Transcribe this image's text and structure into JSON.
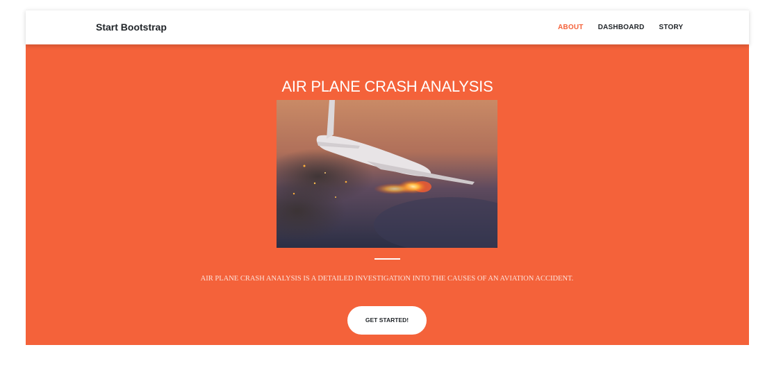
{
  "navbar": {
    "brand": "Start Bootstrap",
    "links": [
      {
        "label": "ABOUT",
        "active": true
      },
      {
        "label": "DASHBOARD",
        "active": false
      },
      {
        "label": "STORY",
        "active": false
      }
    ]
  },
  "hero": {
    "title": "AIR PLANE CRASH ANALYSIS",
    "lead": "AIR PLANE CRASH ANALYSIS IS A DETAILED INVESTIGATION INTO THE CAUSES OF AN AVIATION ACCIDENT.",
    "cta_label": "GET STARTED!",
    "image_icon": "burning-airplane-image"
  },
  "colors": {
    "primary": "#f4623a",
    "text_dark": "#212529",
    "white": "#ffffff"
  }
}
